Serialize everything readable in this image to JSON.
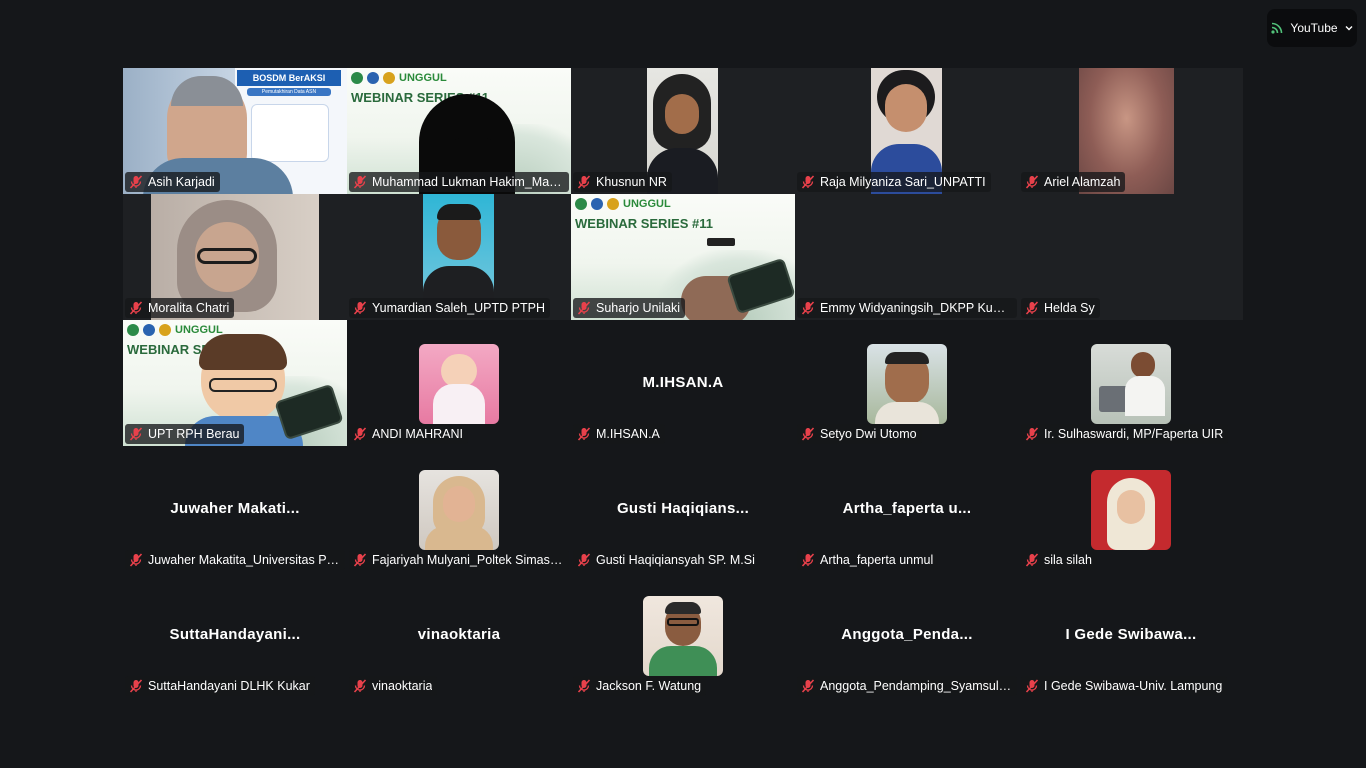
{
  "youtube_button": {
    "label": "YouTube"
  },
  "participants": [
    {
      "name": "Asih Karjadi",
      "kind": "video",
      "video": "bosdm"
    },
    {
      "name": "Muhammad Lukman Hakim_Mah...",
      "kind": "video",
      "video": "webinar-obscured"
    },
    {
      "name": "Khusnun NR",
      "kind": "video",
      "video": "hijab-person"
    },
    {
      "name": "Raja Milyaniza Sari_UNPATTI",
      "kind": "video",
      "video": "woman-glasses"
    },
    {
      "name": "Ariel Alamzah",
      "kind": "video",
      "video": "blurred"
    },
    {
      "name": "Moralita Chatri",
      "kind": "video",
      "video": "blurred-glasses"
    },
    {
      "name": "Yumardian Saleh_UPTD PTPH",
      "kind": "video",
      "video": "man-dark"
    },
    {
      "name": "Suharjo Unilaki",
      "kind": "video",
      "video": "webinar-hand"
    },
    {
      "name": "Emmy Widyaningsih_DKPP Kubu ...",
      "kind": "none"
    },
    {
      "name": "Helda Sy",
      "kind": "none"
    },
    {
      "name": "UPT RPH Berau",
      "kind": "video",
      "video": "webinar-avatar"
    },
    {
      "name": "ANDI MAHRANI",
      "kind": "avatar",
      "video": "baby"
    },
    {
      "name": "M.IHSAN.A",
      "kind": "text",
      "display": "M.IHSAN.A"
    },
    {
      "name": "Setyo Dwi Utomo",
      "kind": "avatar",
      "video": "man-outdoor"
    },
    {
      "name": "Ir. Sulhaswardi, MP/Faperta UIR",
      "kind": "avatar",
      "video": "speaker"
    },
    {
      "name": "Juwaher Makatita_Universitas Pa...",
      "kind": "text",
      "display": "Juwaher  Makati..."
    },
    {
      "name": "Fajariyah Mulyani_Poltek Simas B...",
      "kind": "avatar",
      "video": "hijab-woman"
    },
    {
      "name": "Gusti Haqiqiansyah SP. M.Si",
      "kind": "text",
      "display": "Gusti  Haqiqians..."
    },
    {
      "name": "Artha_faperta unmul",
      "kind": "text",
      "display": "Artha_faperta  u..."
    },
    {
      "name": "sila silah",
      "kind": "avatar",
      "video": "hijab-red"
    },
    {
      "name": "SuttaHandayani DLHK Kukar",
      "kind": "text",
      "display": "SuttaHandayani..."
    },
    {
      "name": "vinaoktaria",
      "kind": "text",
      "display": "vinaoktaria"
    },
    {
      "name": "Jackson F. Watung",
      "kind": "avatar",
      "video": "man-batik"
    },
    {
      "name": "Anggota_Pendamping_Syamsul ...",
      "kind": "text",
      "display": "Anggota_Penda..."
    },
    {
      "name": "I Gede Swibawa-Univ. Lampung",
      "kind": "text",
      "display": "I  Gede  Swibawa..."
    }
  ],
  "slides": {
    "bosdm_title": "BOSDM BerAKSI",
    "bosdm_sub": "Pemutakhiran Data ASN",
    "webinar_title": "WEBINAR SERIES #11",
    "webinar_brand": "UNGGUL"
  },
  "colors": {
    "mic_muted": "#e8414b",
    "background": "#15171a"
  }
}
